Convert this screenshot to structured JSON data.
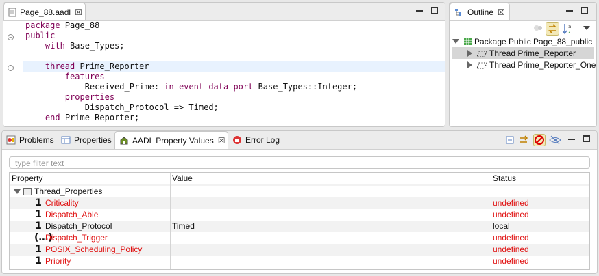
{
  "editor": {
    "tab_label": "Page_88.aadl",
    "tab_close": "☒",
    "lines": [
      {
        "indent": "",
        "parts": [
          {
            "t": "package",
            "k": true
          },
          {
            "t": " Page_88",
            "k": false
          }
        ]
      },
      {
        "indent": "",
        "parts": [
          {
            "t": "public",
            "k": true
          }
        ]
      },
      {
        "indent": "    ",
        "parts": [
          {
            "t": "with",
            "k": true
          },
          {
            "t": " Base_Types;",
            "k": false
          }
        ]
      },
      {
        "indent": "",
        "parts": []
      },
      {
        "indent": "    ",
        "parts": [
          {
            "t": "thread",
            "k": true
          },
          {
            "t": " Prime_Reporter",
            "k": false
          }
        ]
      },
      {
        "indent": "        ",
        "parts": [
          {
            "t": "features",
            "k": true
          }
        ]
      },
      {
        "indent": "            ",
        "parts": [
          {
            "t": "Received_Prime: ",
            "k": false
          },
          {
            "t": "in event data port",
            "k": true
          },
          {
            "t": " Base_Types::Integer;",
            "k": false
          }
        ]
      },
      {
        "indent": "        ",
        "parts": [
          {
            "t": "properties",
            "k": true
          }
        ]
      },
      {
        "indent": "            ",
        "parts": [
          {
            "t": "Dispatch_Protocol => Timed;",
            "k": false
          }
        ]
      },
      {
        "indent": "    ",
        "parts": [
          {
            "t": "end",
            "k": true
          },
          {
            "t": " Prime_Reporter;",
            "k": false
          }
        ]
      }
    ]
  },
  "outline": {
    "tab_label": "Outline",
    "tab_close": "☒",
    "items": [
      {
        "label": "Package Public Page_88_public"
      },
      {
        "label": "Thread Prime_Reporter"
      },
      {
        "label": "Thread Prime_Reporter_One"
      }
    ]
  },
  "bottom": {
    "tabs": [
      {
        "label": "Problems"
      },
      {
        "label": "Properties"
      },
      {
        "label": "AADL Property Values"
      },
      {
        "label": "Error Log"
      }
    ],
    "active_close": "☒",
    "filter_placeholder": "type filter text",
    "columns": {
      "property": "Property",
      "value": "Value",
      "status": "Status"
    },
    "group_label": "Thread_Properties",
    "rows": [
      {
        "name": "Criticality",
        "value": "",
        "status": "undefined",
        "icon": "1",
        "red": true
      },
      {
        "name": "Dispatch_Able",
        "value": "",
        "status": "undefined",
        "icon": "1",
        "red": true
      },
      {
        "name": "Dispatch_Protocol",
        "value": "Timed",
        "status": "local",
        "icon": "1",
        "red": false
      },
      {
        "name": "Dispatch_Trigger",
        "value": "",
        "status": "undefined",
        "icon": "(…)",
        "red": true
      },
      {
        "name": "POSIX_Scheduling_Policy",
        "value": "",
        "status": "undefined",
        "icon": "1",
        "red": true
      },
      {
        "name": "Priority",
        "value": "",
        "status": "undefined",
        "icon": "1",
        "red": true
      }
    ]
  },
  "colors": {
    "keyword": "#7f0055",
    "undefined": "#e01010",
    "highlight": "#e8f2fe"
  }
}
